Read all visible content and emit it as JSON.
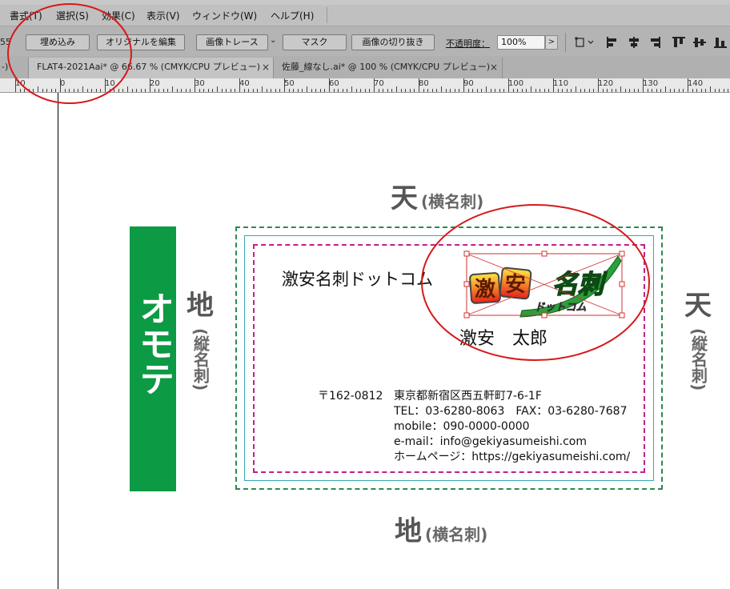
{
  "menubar": {
    "items": [
      {
        "label": "書式(T)"
      },
      {
        "label": "選択(S)"
      },
      {
        "label": "効果(C)"
      },
      {
        "label": "表示(V)"
      },
      {
        "label": "ウィンドウ(W)"
      },
      {
        "label": "ヘルプ(H)"
      }
    ]
  },
  "controlbar": {
    "left_readout": "55",
    "embed": "埋め込み",
    "edit_original": "オリジナルを編集",
    "image_trace": "画像トレース",
    "mask": "マスク",
    "crop_image": "画像の切り抜き",
    "opacity_label": "不透明度：",
    "opacity_value": "100%",
    "opacity_arrow": ">",
    "dropdown_arrow": "⌄"
  },
  "tabs": {
    "left_stub": "-)",
    "items": [
      {
        "label": "FLAT4-2021Aai* @ 66.67 % (CMYK/CPU プレビュー)",
        "close": "×"
      },
      {
        "label": "佐藤_線なし.ai* @ 100 % (CMYK/CPU プレビュー)",
        "close": "×"
      }
    ]
  },
  "ruler": {
    "labels": [
      "10",
      "0",
      "10",
      "20",
      "30",
      "40",
      "50",
      "60",
      "70",
      "80",
      "90",
      "100",
      "110",
      "120",
      "130",
      "140"
    ]
  },
  "canvas": {
    "top_label_big": "天",
    "top_label_small": "(横名刺)",
    "bottom_label_big": "地",
    "bottom_label_small": "(横名刺)",
    "left_label_big": "地",
    "left_label_small": "(縦名刺)",
    "right_label_big": "天",
    "right_label_small": "(縦名刺)",
    "omote": "オモテ",
    "colors": {
      "green": "#0c9a44",
      "trim_teal": "#33a9b8",
      "bleed_green": "#2b8a4c",
      "safe_magenta": "#c0208c",
      "annotation_red": "#d81818",
      "selection": "#d03030"
    }
  },
  "card": {
    "company": "激安名刺ドットコム",
    "name": "激安　太郎",
    "postal": "〒162-0812",
    "address": "東京都新宿区西五軒町7-6-1F",
    "tel_fax": "TEL：03-6280-8063　FAX：03-6280-7687",
    "mobile": "mobile：090-0000-0000",
    "email": "e-mail：info@gekiyasumeishi.com",
    "homepage": "ホームページ：https://gekiyasumeishi.com/",
    "logo": {
      "main": "激安名刺",
      "sub": "ドットコム"
    }
  }
}
